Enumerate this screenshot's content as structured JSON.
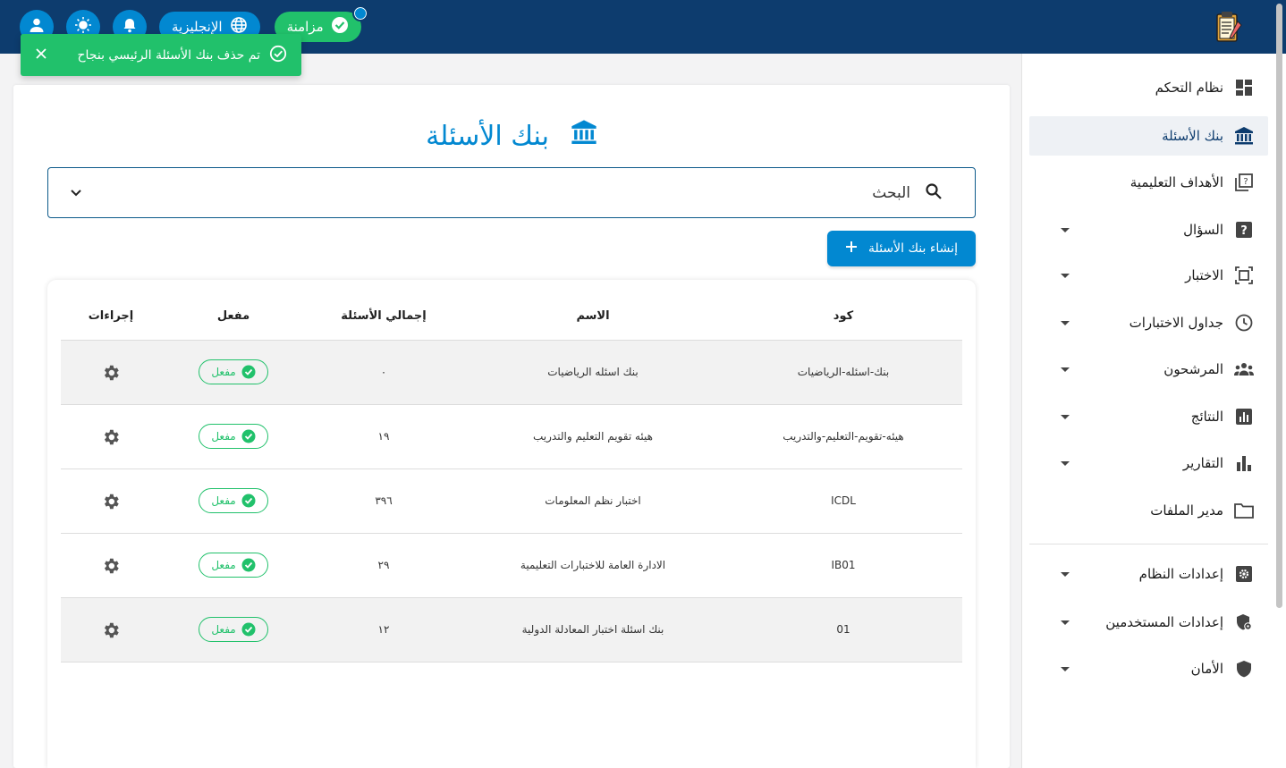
{
  "colors": {
    "topbar": "#0d3c6e",
    "accent": "#0288d1",
    "success": "#21c16b"
  },
  "topbar": {
    "logo_icon": "exam-clipboard-icon",
    "sync_label": "مزامنة",
    "language_label": "الإنجليزية",
    "icons": [
      "user-icon",
      "theme-sun-icon",
      "bell-icon",
      "globe-icon",
      "check-circle-icon"
    ]
  },
  "toast": {
    "message": "تم حذف بنك الأسئلة الرئيسي بنجاح"
  },
  "sidebar": {
    "items": [
      {
        "label": "نظام التحكم",
        "icon": "dashboard-icon"
      },
      {
        "label": "بنك الأسئلة",
        "icon": "bank-icon",
        "active": true
      },
      {
        "label": "الأهداف التعليمية",
        "icon": "objectives-icon"
      },
      {
        "label": "السؤال",
        "icon": "question-icon",
        "expandable": true
      },
      {
        "label": "الاختبار",
        "icon": "exam-icon",
        "expandable": true
      },
      {
        "label": "جداول الاختبارات",
        "icon": "clock-icon",
        "expandable": true
      },
      {
        "label": "المرشحون",
        "icon": "people-icon",
        "expandable": true
      },
      {
        "label": "النتائج",
        "icon": "results-icon",
        "expandable": true
      },
      {
        "label": "التقارير",
        "icon": "reports-icon",
        "expandable": true
      },
      {
        "label": "مدير الملفات",
        "icon": "folder-icon"
      },
      {
        "label": "إعدادات النظام",
        "icon": "system-settings-icon",
        "expandable": true
      },
      {
        "label": "إعدادات المستخدمين",
        "icon": "user-settings-icon",
        "expandable": true
      },
      {
        "label": "الأمان",
        "icon": "shield-icon",
        "expandable": true
      }
    ]
  },
  "main": {
    "title": "بنك الأسئلة",
    "search_label": "البحث",
    "create_button": "إنشاء بنك الأسئلة",
    "table": {
      "headers": {
        "code": "كود",
        "name": "الاسم",
        "total": "إجمالي الأسئلة",
        "active": "مفعل",
        "actions": "إجراءات"
      },
      "rows": [
        {
          "code": "بنك-اسئله-الرياضيات",
          "name": "بنك اسئله الرياضيات",
          "total": "٠",
          "status": "مفعل"
        },
        {
          "code": "هيئه-تقويم-التعليم-والتدريب",
          "name": "هيئه تقويم التعليم والتدريب",
          "total": "١٩",
          "status": "مفعل"
        },
        {
          "code": "ICDL",
          "name": "اختبار نظم المعلومات",
          "total": "٣٩٦",
          "status": "مفعل"
        },
        {
          "code": "IB01",
          "name": "الادارة العامة للاختبارات التعليمية",
          "total": "٢٩",
          "status": "مفعل"
        },
        {
          "code": "01",
          "name": "بنك اسئلة اختبار المعادلة الدولية",
          "total": "١٢",
          "status": "مفعل"
        }
      ]
    }
  }
}
